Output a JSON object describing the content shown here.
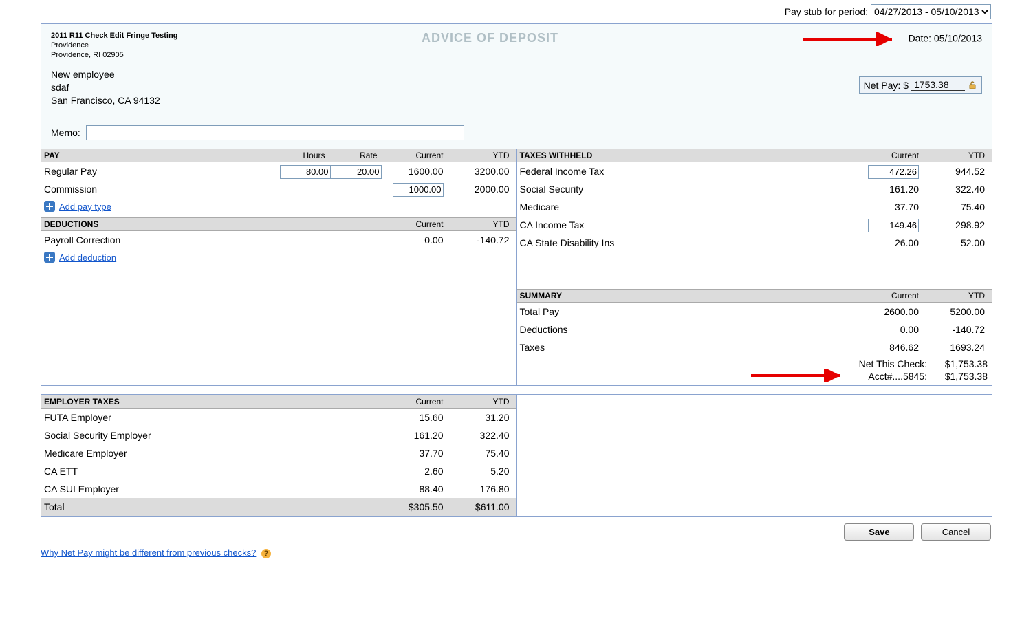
{
  "period": {
    "label": "Pay stub for period:",
    "value": "04/27/2013 - 05/10/2013"
  },
  "check_header": {
    "company_line1": "2011 R11 Check Edit Fringe Testing",
    "company_line2": "Providence",
    "company_line3": "Providence, RI 02905",
    "advice_title": "ADVICE OF DEPOSIT",
    "date_label": "Date:",
    "date_value": "05/10/2013"
  },
  "payee": {
    "line1": "New employee",
    "line2": "sdaf",
    "line3": "San Francisco, CA 94132"
  },
  "netpay": {
    "label": "Net Pay: $",
    "value": "1753.38"
  },
  "memo": {
    "label": "Memo:",
    "value": ""
  },
  "pay": {
    "title": "PAY",
    "col_hours": "Hours",
    "col_rate": "Rate",
    "col_current": "Current",
    "col_ytd": "YTD",
    "rows": [
      {
        "label": "Regular Pay",
        "hours": "80.00",
        "rate": "20.00",
        "current": "1600.00",
        "ytd": "3200.00",
        "has_hours": true
      },
      {
        "label": "Commission",
        "hours": "",
        "rate": "",
        "current": "1000.00",
        "ytd": "2000.00",
        "has_hours": false
      }
    ],
    "add_label": "Add pay type"
  },
  "deductions": {
    "title": "DEDUCTIONS",
    "col_current": "Current",
    "col_ytd": "YTD",
    "rows": [
      {
        "label": "Payroll Correction",
        "current": "0.00",
        "ytd": "-140.72"
      }
    ],
    "add_label": "Add deduction"
  },
  "taxes": {
    "title": "TAXES WITHHELD",
    "col_current": "Current",
    "col_ytd": "YTD",
    "rows": [
      {
        "label": "Federal Income Tax",
        "current": "472.26",
        "ytd": "944.52",
        "editable": true
      },
      {
        "label": "Social Security",
        "current": "161.20",
        "ytd": "322.40",
        "editable": false
      },
      {
        "label": "Medicare",
        "current": "37.70",
        "ytd": "75.40",
        "editable": false
      },
      {
        "label": "CA Income Tax",
        "current": "149.46",
        "ytd": "298.92",
        "editable": true
      },
      {
        "label": "CA State Disability Ins",
        "current": "26.00",
        "ytd": "52.00",
        "editable": false
      }
    ]
  },
  "summary": {
    "title": "SUMMARY",
    "col_current": "Current",
    "col_ytd": "YTD",
    "rows": [
      {
        "label": "Total Pay",
        "current": "2600.00",
        "ytd": "5200.00"
      },
      {
        "label": "Deductions",
        "current": "0.00",
        "ytd": "-140.72"
      },
      {
        "label": "Taxes",
        "current": "846.62",
        "ytd": "1693.24"
      }
    ],
    "net_this_check_label": "Net This Check:",
    "net_this_check_value": "$1,753.38",
    "acct_label": "Acct#....5845:",
    "acct_value": "$1,753.38"
  },
  "employer_taxes": {
    "title": "EMPLOYER TAXES",
    "col_current": "Current",
    "col_ytd": "YTD",
    "rows": [
      {
        "label": "FUTA Employer",
        "current": "15.60",
        "ytd": "31.20"
      },
      {
        "label": "Social Security Employer",
        "current": "161.20",
        "ytd": "322.40"
      },
      {
        "label": "Medicare Employer",
        "current": "37.70",
        "ytd": "75.40"
      },
      {
        "label": "CA ETT",
        "current": "2.60",
        "ytd": "5.20"
      },
      {
        "label": "CA SUI Employer",
        "current": "88.40",
        "ytd": "176.80"
      }
    ],
    "total_label": "Total",
    "total_current": "$305.50",
    "total_ytd": "$611.00"
  },
  "buttons": {
    "save": "Save",
    "cancel": "Cancel"
  },
  "footer_link": "Why Net Pay might be different from previous checks?"
}
